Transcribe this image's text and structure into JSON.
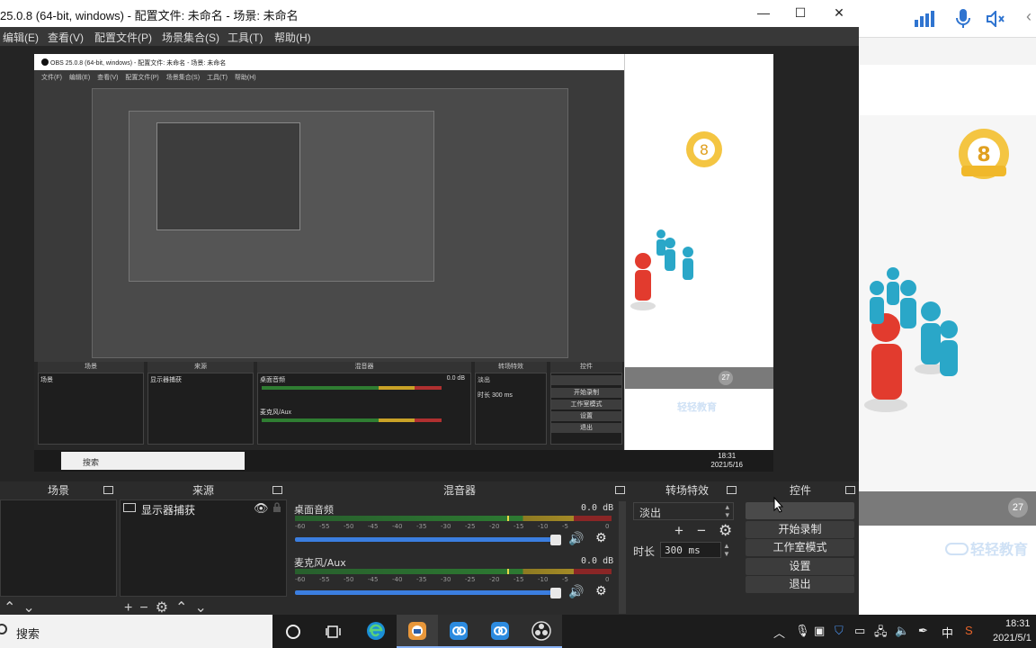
{
  "window": {
    "title": "25.0.8 (64-bit, windows) - 配置文件: 未命名 - 场景: 未命名",
    "minimize": "—",
    "maximize": "☐",
    "close": "✕"
  },
  "menu": [
    "编辑(E)",
    "查看(V)",
    "配置文件(P)",
    "场景集合(S)",
    "工具(T)",
    "帮助(H)"
  ],
  "capture": {
    "title": "OBS 25.0.8 (64-bit, windows) - 配置文件: 未命名 - 场景: 未命名",
    "menu": "文件(F) 编辑(E) 查看(V) 配置文件(P) 场景集合(S) 工具(T) 帮助(H)",
    "docks": [
      "场景",
      "来源",
      "混音器",
      "转场特效",
      "控件"
    ],
    "scene_item": "场景",
    "source_item": "显示器捕获",
    "mixer": [
      {
        "name": "桌面音频",
        "db": "0.0 dB"
      },
      {
        "name": "麦克风/Aux",
        "db": "0.0 dB"
      }
    ],
    "transition": "淡出",
    "duration_label": "时长",
    "duration": "300 ms",
    "controls": [
      "",
      "开始录制",
      "工作室模式",
      "设置",
      "退出"
    ],
    "search": "搜索",
    "clock_time": "18:31",
    "clock_date": "2021/5/16",
    "badge": "27",
    "brand": "轻轻教育"
  },
  "docks": {
    "scenes": {
      "title": "场景"
    },
    "sources": {
      "title": "来源",
      "items": [
        {
          "label": "显示器捕获"
        }
      ]
    },
    "mixer": {
      "title": "混音器",
      "channels": [
        {
          "name": "桌面音频",
          "db": "0.0 dB"
        },
        {
          "name": "麦克风/Aux",
          "db": "0.0 dB"
        }
      ],
      "ticks": [
        "-60",
        "-55",
        "-50",
        "-45",
        "-40",
        "-35",
        "-30",
        "-25",
        "-20",
        "-15",
        "-10",
        "-5",
        "0"
      ]
    },
    "transitions": {
      "title": "转场特效",
      "selected": "淡出",
      "duration_label": "时长",
      "duration": "300 ms"
    },
    "controls": {
      "title": "控件",
      "buttons": [
        "",
        "开始录制",
        "工作室模式",
        "设置",
        "退出"
      ]
    }
  },
  "website": {
    "badge": "27",
    "brand": "轻轻教育"
  },
  "taskbar": {
    "search_placeholder": "搜索",
    "ime": "中",
    "time": "18:31",
    "date": "2021/5/1"
  }
}
